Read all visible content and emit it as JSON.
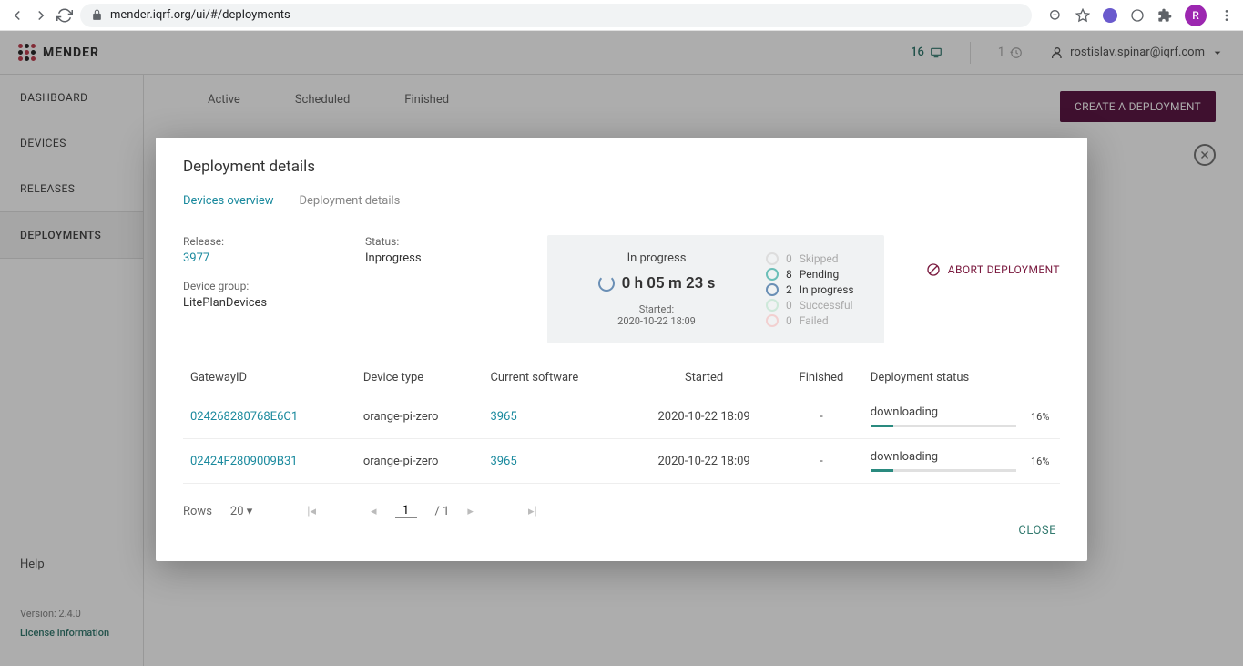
{
  "browser": {
    "url": "mender.iqrf.org/ui/#/deployments",
    "avatar_letter": "R"
  },
  "header": {
    "brand": "MENDER",
    "devices_count": "16",
    "pending_count": "1",
    "user_email": "rostislav.spinar@iqrf.com"
  },
  "sidebar": {
    "items": [
      "DASHBOARD",
      "DEVICES",
      "RELEASES",
      "DEPLOYMENTS"
    ],
    "help": "Help",
    "version": "Version: 2.4.0",
    "license": "License information"
  },
  "main": {
    "tabs": [
      "Active",
      "Scheduled",
      "Finished"
    ],
    "create_btn": "CREATE A DEPLOYMENT"
  },
  "modal": {
    "title": "Deployment details",
    "tabs": {
      "overview": "Devices overview",
      "details": "Deployment details"
    },
    "release_label": "Release:",
    "release_value": "3977",
    "group_label": "Device group:",
    "group_value": "LitePlanDevices",
    "status_label": "Status:",
    "status_value": "Inprogress",
    "progress_label": "In progress",
    "elapsed": "0 h 05 m 23 s",
    "started_label": "Started:",
    "started_value": "2020-10-22 18:09",
    "stats": {
      "skipped": {
        "n": "0",
        "label": "Skipped"
      },
      "pending": {
        "n": "8",
        "label": "Pending"
      },
      "inprogress": {
        "n": "2",
        "label": "In progress"
      },
      "successful": {
        "n": "0",
        "label": "Successful"
      },
      "failed": {
        "n": "0",
        "label": "Failed"
      }
    },
    "abort_label": "ABORT DEPLOYMENT",
    "columns": {
      "gateway": "GatewayID",
      "type": "Device type",
      "sw": "Current software",
      "started": "Started",
      "finished": "Finished",
      "status": "Deployment status"
    },
    "rows": [
      {
        "id": "024268280768E6C1",
        "type": "orange-pi-zero",
        "sw": "3965",
        "started": "2020-10-22 18:09",
        "finished": "-",
        "status": "downloading",
        "pct": "16%",
        "pct_w": "16%"
      },
      {
        "id": "02424F2809009B31",
        "type": "orange-pi-zero",
        "sw": "3965",
        "started": "2020-10-22 18:09",
        "finished": "-",
        "status": "downloading",
        "pct": "16%",
        "pct_w": "16%"
      }
    ],
    "pagination": {
      "rows_label": "Rows",
      "rows_value": "20",
      "page": "1",
      "total": "/ 1"
    },
    "close": "CLOSE"
  }
}
